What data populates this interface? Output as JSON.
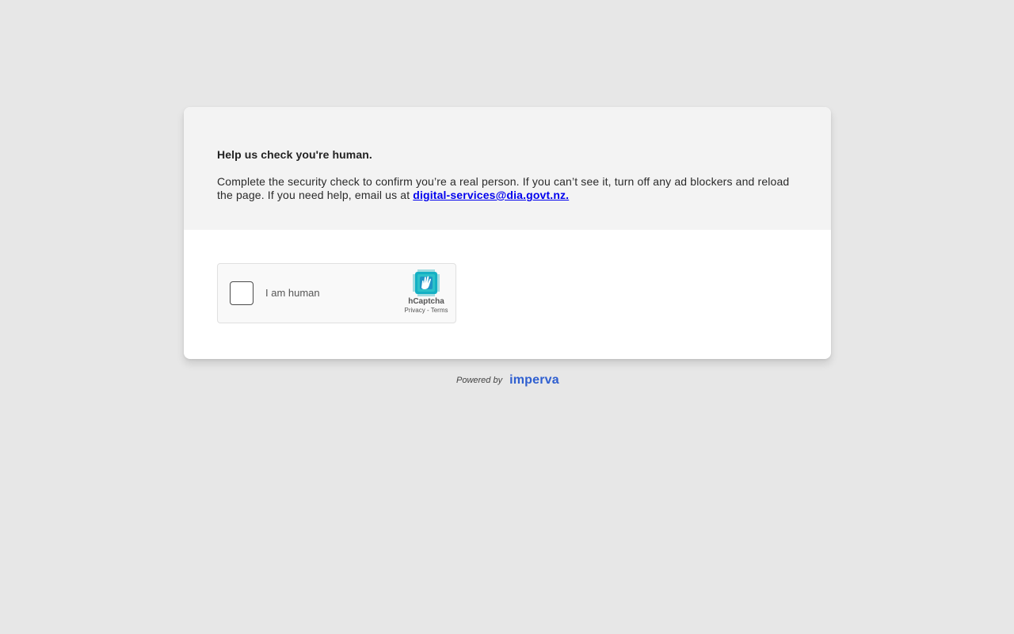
{
  "heading": "Help us check you're human.",
  "message": {
    "text": "Complete the security check to confirm you’re a real person. If you can’t see it, turn off any ad blockers and reload the page. If you need help, email us at ",
    "email": "digital-services@dia.govt.nz."
  },
  "captcha": {
    "label": "I am human",
    "brand": "hCaptcha",
    "privacy": "Privacy",
    "separator": " - ",
    "terms": "Terms"
  },
  "footer": {
    "powered_by": "Powered by",
    "vendor": "imperva"
  },
  "colors": {
    "page_background": "#e7e7e7",
    "card_top": "#f3f3f3",
    "link": "#0000ee",
    "imperva_blue": "#2f5fd0"
  }
}
